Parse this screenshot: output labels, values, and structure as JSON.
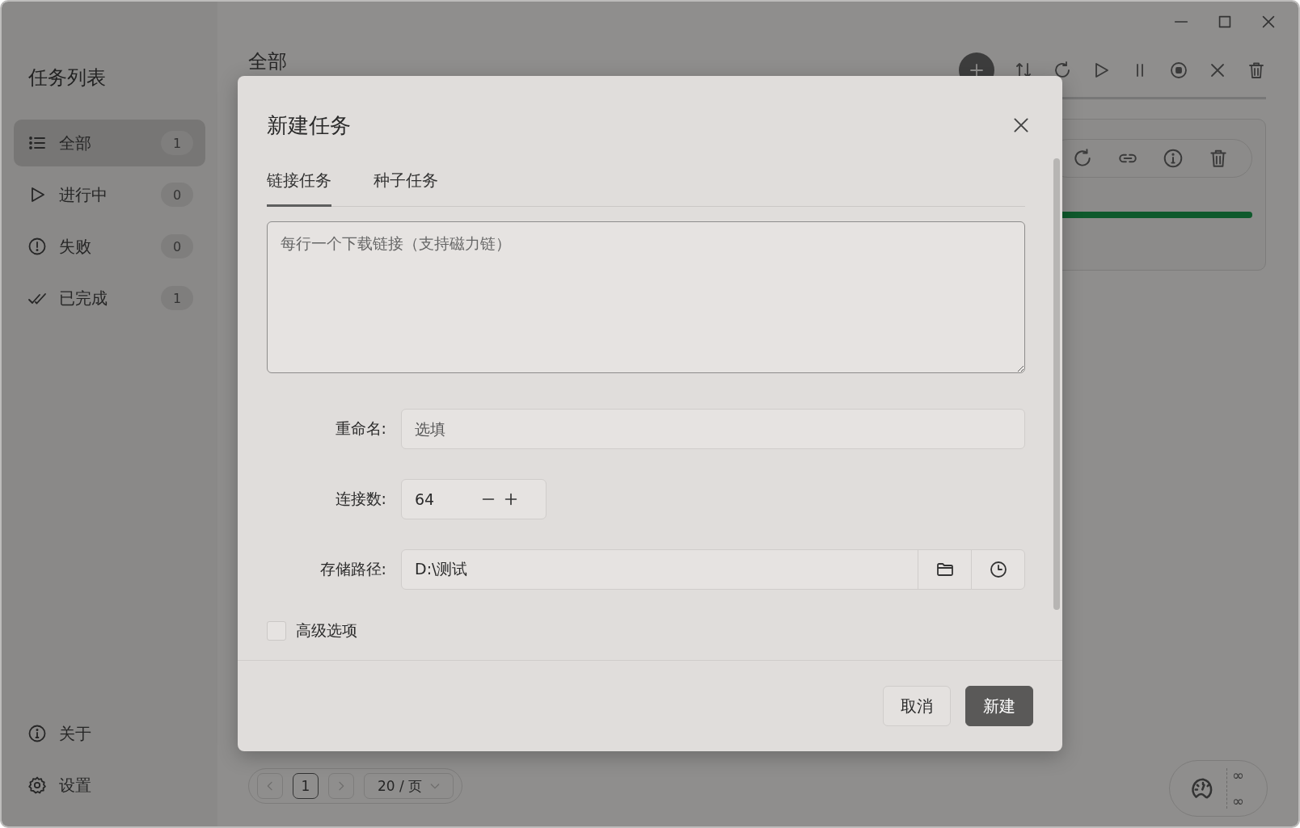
{
  "sidebar": {
    "title": "任务列表",
    "items": [
      {
        "label": "全部",
        "count": "1",
        "selected": true
      },
      {
        "label": "进行中",
        "count": "0",
        "selected": false
      },
      {
        "label": "失败",
        "count": "0",
        "selected": false
      },
      {
        "label": "已完成",
        "count": "1",
        "selected": false
      }
    ],
    "footer_items": [
      {
        "label": "关于"
      },
      {
        "label": "设置"
      }
    ]
  },
  "main": {
    "heading": "全部",
    "tasks": [
      {
        "level": 1
      }
    ],
    "pagination": {
      "page": "1",
      "page_size": "20 / 页"
    },
    "speed": {
      "upload": "∞",
      "download": "∞"
    }
  },
  "dialog": {
    "title": "新建任务",
    "tabs": [
      {
        "label": "链接任务",
        "selected": true
      },
      {
        "label": "种子任务",
        "selected": false
      }
    ],
    "links": {
      "placeholder": "每行一个下载链接（支持磁力链）"
    },
    "fields": [
      {
        "kind": "text",
        "label": "重命名:",
        "placeholder": "选填"
      },
      {
        "kind": "stepper",
        "label": "连接数:",
        "value": "64"
      },
      {
        "kind": "path",
        "label": "存储路径:",
        "value": "D:\\测试"
      }
    ],
    "advanced": {
      "label": "高级选项",
      "checked": false
    },
    "buttons": [
      {
        "kind": "secondary",
        "label": "取消"
      },
      {
        "kind": "primary",
        "label": "新建"
      }
    ]
  }
}
